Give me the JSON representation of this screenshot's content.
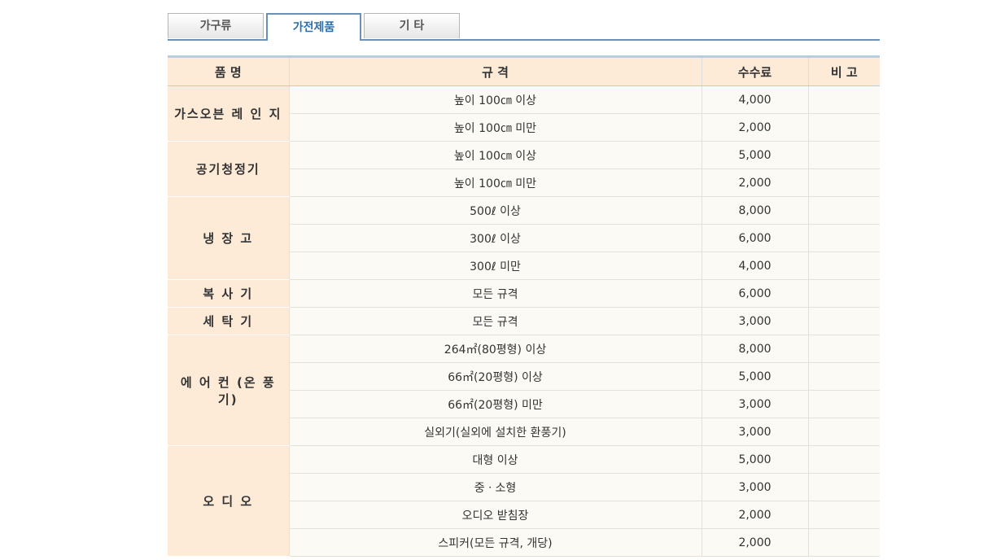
{
  "tabs": [
    "가구류",
    "가전제품",
    "기   타"
  ],
  "active_tab": 1,
  "table": {
    "headers": {
      "name": "품 명",
      "spec": "규 격",
      "fee": "수수료",
      "note": "비 고"
    },
    "groups": [
      {
        "name": "가스오븐 레 인 지",
        "rows": [
          {
            "spec": "높이 100㎝ 이상",
            "fee": "4,000",
            "note": ""
          },
          {
            "spec": "높이 100㎝ 미만",
            "fee": "2,000",
            "note": ""
          }
        ]
      },
      {
        "name": "공기청정기",
        "rows": [
          {
            "spec": "높이 100㎝ 이상",
            "fee": "5,000",
            "note": ""
          },
          {
            "spec": "높이 100㎝ 미만",
            "fee": "2,000",
            "note": ""
          }
        ]
      },
      {
        "name": "냉 장 고",
        "rows": [
          {
            "spec": "500ℓ 이상",
            "fee": "8,000",
            "note": ""
          },
          {
            "spec": "300ℓ 이상",
            "fee": "6,000",
            "note": ""
          },
          {
            "spec": "300ℓ 미만",
            "fee": "4,000",
            "note": ""
          }
        ]
      },
      {
        "name": "복 사 기",
        "rows": [
          {
            "spec": "모든 규격",
            "fee": "6,000",
            "note": ""
          }
        ]
      },
      {
        "name": "세 탁 기",
        "rows": [
          {
            "spec": "모든 규격",
            "fee": "3,000",
            "note": ""
          }
        ]
      },
      {
        "name": "에 어 컨 (온 풍 기)",
        "rows": [
          {
            "spec": "264㎡(80평형) 이상",
            "fee": "8,000",
            "note": ""
          },
          {
            "spec": "66㎡(20평형) 이상",
            "fee": "5,000",
            "note": ""
          },
          {
            "spec": "66㎡(20평형) 미만",
            "fee": "3,000",
            "note": ""
          },
          {
            "spec": "실외기(실외에 설치한 환풍기)",
            "fee": "3,000",
            "note": ""
          }
        ]
      },
      {
        "name": "오 디 오",
        "rows": [
          {
            "spec": "대형 이상",
            "fee": "5,000",
            "note": ""
          },
          {
            "spec": "중ㆍ소형",
            "fee": "3,000",
            "note": ""
          },
          {
            "spec": "오디오 받침장",
            "fee": "2,000",
            "note": ""
          },
          {
            "spec": "스피커(모든 규격, 개당)",
            "fee": "2,000",
            "note": ""
          }
        ]
      }
    ]
  }
}
